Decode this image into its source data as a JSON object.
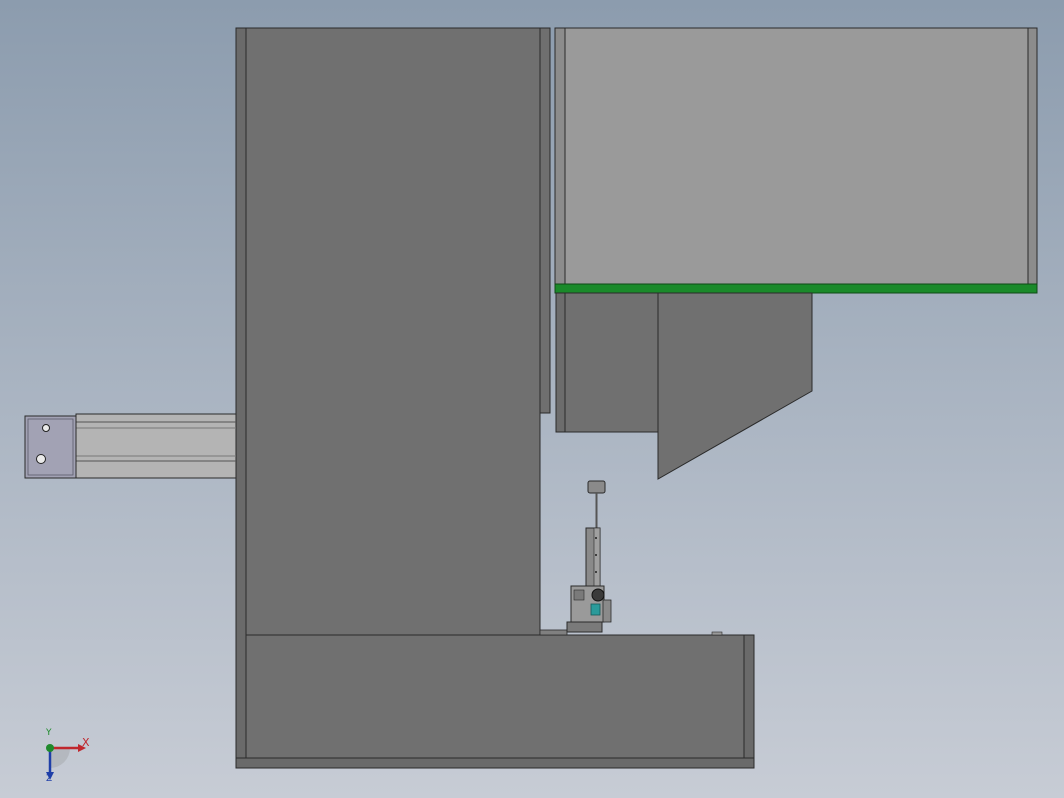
{
  "view": {
    "background_top": "#8c9cae",
    "background_bottom": "#c7ccd5"
  },
  "colors": {
    "body_dark": "#707070",
    "body_light": "#9a9a9a",
    "edge": "#2a2a2a",
    "accent_strip": "#1a8a2a",
    "rail": "#b4b4b4",
    "cyan_part": "#2a9a9a"
  },
  "triad": {
    "x_label": "X",
    "y_label": "Y",
    "z_label": "Z"
  }
}
